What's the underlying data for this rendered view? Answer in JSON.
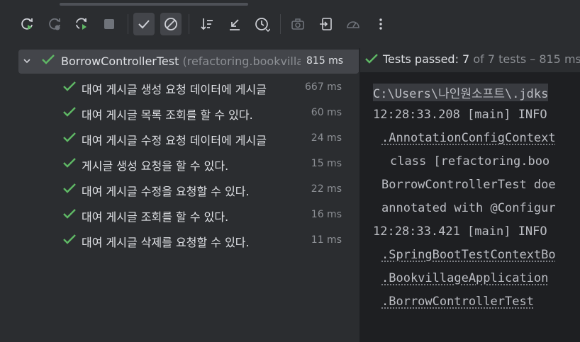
{
  "toolbar": {
    "buttons": [
      {
        "name": "rerun-icon"
      },
      {
        "name": "rerun-failed-icon"
      },
      {
        "name": "toggle-auto-test-icon"
      },
      {
        "name": "stop-icon"
      },
      {
        "name": "show-passed-icon"
      },
      {
        "name": "show-ignored-icon"
      },
      {
        "name": "sort-icon"
      },
      {
        "name": "collapse-icon"
      },
      {
        "name": "history-icon"
      },
      {
        "name": "screenshot-icon"
      },
      {
        "name": "import-icon"
      },
      {
        "name": "coverage-icon"
      },
      {
        "name": "more-icon"
      }
    ]
  },
  "tree": {
    "root": {
      "name": "BorrowControllerTest",
      "package": "(refactoring.bookvilla",
      "duration": "815 ms"
    },
    "tests": [
      {
        "name": "대여 게시글 생성 요청 데이터에 게시글",
        "duration": "667 ms"
      },
      {
        "name": "대여 게시글 목록 조회를 할 수 있다.",
        "duration": "60 ms"
      },
      {
        "name": "대여 게시글 수정 요청 데이터에 게시글",
        "duration": "24 ms"
      },
      {
        "name": "게시글 생성 요청을 할 수 있다.",
        "duration": "15 ms"
      },
      {
        "name": "대여 게시글 수정을 요청할 수 있다.",
        "duration": "22 ms"
      },
      {
        "name": "대여 게시글 조회를 할 수 있다.",
        "duration": "16 ms"
      },
      {
        "name": "대여 게시글 삭제를 요청할 수 있다.",
        "duration": "11 ms"
      }
    ]
  },
  "status": {
    "passed_label": "Tests passed: 7",
    "total_label": "of 7 tests – 815 ms"
  },
  "console": {
    "lines": [
      "C:\\Users\\나인원소프트\\.jdks",
      "12:28:33.208 [main] INFO",
      ".AnnotationConfigContext",
      "class [refactoring.boo",
      "BorrowControllerTest doe",
      "annotated with @Configur",
      "12:28:33.421 [main] INFO",
      ".SpringBootTestContextBo",
      ".BookvillageApplication",
      ".BorrowControllerTest"
    ]
  },
  "colors": {
    "pass_green": "#5fb865",
    "blue": "#3592c4",
    "panel_bg": "#2b2d30",
    "console_bg": "#1e1f22"
  }
}
